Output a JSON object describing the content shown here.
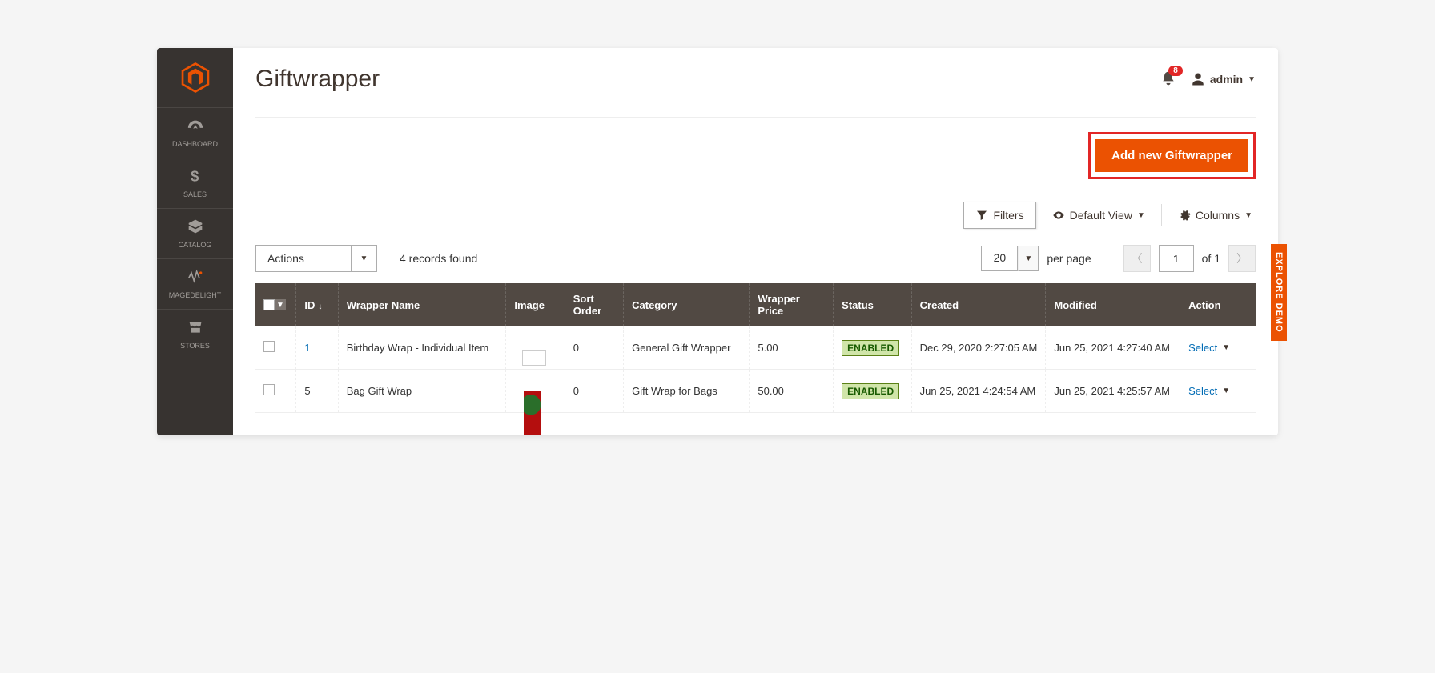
{
  "page": {
    "title": "Giftwrapper"
  },
  "header": {
    "notif_count": "8",
    "user_label": "admin"
  },
  "buttons": {
    "add_new": "Add new Giftwrapper",
    "filters": "Filters",
    "default_view": "Default View",
    "columns": "Columns"
  },
  "sidebar": {
    "items": [
      {
        "label": "DASHBOARD"
      },
      {
        "label": "SALES"
      },
      {
        "label": "CATALOG"
      },
      {
        "label": "MAGEDELIGHT"
      },
      {
        "label": "STORES"
      }
    ]
  },
  "controls": {
    "actions_label": "Actions",
    "records_found": "4 records found",
    "per_page_value": "20",
    "per_page_label": "per page",
    "page_current": "1",
    "page_total": "of 1"
  },
  "table": {
    "headers": {
      "id": "ID",
      "name": "Wrapper Name",
      "image": "Image",
      "sort": "Sort Order",
      "category": "Category",
      "price": "Wrapper Price",
      "status": "Status",
      "created": "Created",
      "modified": "Modified",
      "action": "Action"
    },
    "rows": [
      {
        "id": "1",
        "name": "Birthday Wrap - Individual Item",
        "sort": "0",
        "category": "General Gift Wrapper",
        "price": "5.00",
        "status": "ENABLED",
        "created": "Dec 29, 2020 2:27:05 AM",
        "modified": "Jun 25, 2021 4:27:40 AM",
        "action": "Select"
      },
      {
        "id": "5",
        "name": "Bag Gift Wrap",
        "sort": "0",
        "category": "Gift Wrap for Bags",
        "price": "50.00",
        "status": "ENABLED",
        "created": "Jun 25, 2021 4:24:54 AM",
        "modified": "Jun 25, 2021 4:25:57 AM",
        "action": "Select"
      }
    ]
  },
  "explore_tab": "EXPLORE DEMO"
}
